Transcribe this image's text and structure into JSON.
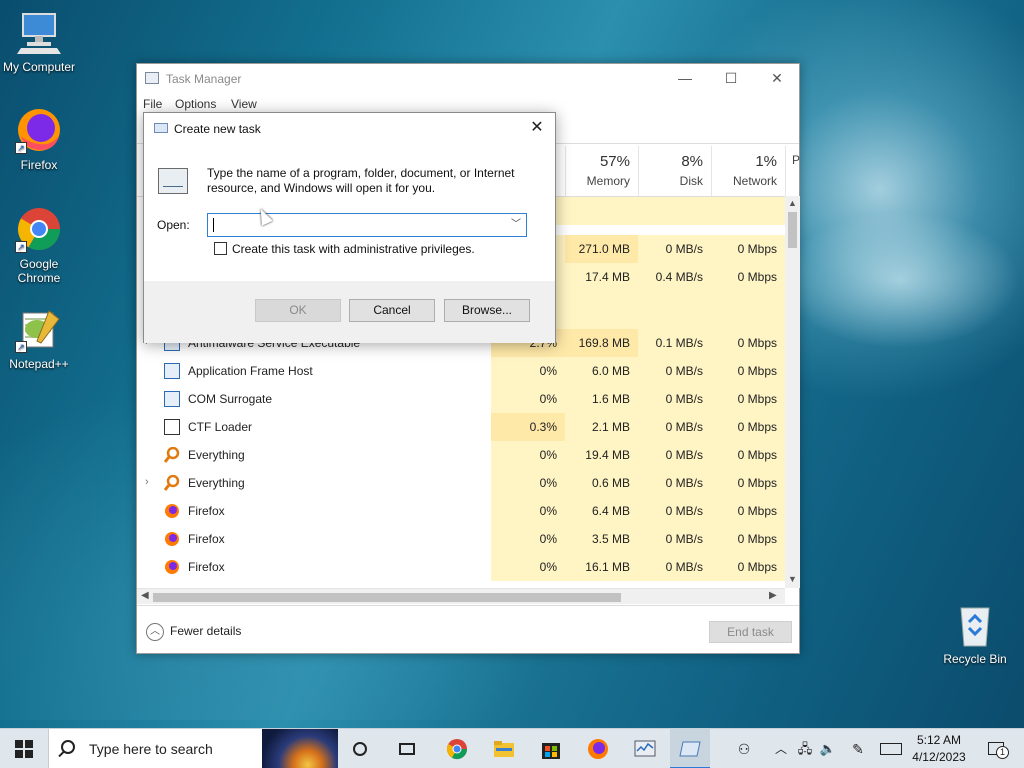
{
  "desktop": {
    "icons": [
      {
        "label": "My Computer"
      },
      {
        "label": "Firefox"
      },
      {
        "label": "Google Chrome"
      },
      {
        "label": "Notepad++"
      },
      {
        "label": "Recycle Bin"
      }
    ]
  },
  "task_manager": {
    "title": "Task Manager",
    "menu": [
      "File",
      "Options",
      "View"
    ],
    "columns": [
      {
        "pct": "57%",
        "name": "Memory"
      },
      {
        "pct": "8%",
        "name": "Disk"
      },
      {
        "pct": "1%",
        "name": "Network"
      },
      {
        "pct": "",
        "name": "P"
      }
    ],
    "rows": [
      {
        "name": "",
        "cpu": "",
        "mem": "",
        "disk": "",
        "net": ""
      },
      {
        "name": "",
        "cpu": "",
        "mem": "271.0 MB",
        "disk": "0 MB/s",
        "net": "0 Mbps"
      },
      {
        "name": "",
        "cpu": "",
        "mem": "17.4 MB",
        "disk": "0.4 MB/s",
        "net": "0 Mbps"
      },
      {
        "name": "",
        "cpu": "",
        "mem": "",
        "disk": "",
        "net": ""
      },
      {
        "name": "Antimalware Service Executable",
        "cpu": "2.7%",
        "mem": "169.8 MB",
        "disk": "0.1 MB/s",
        "net": "0 Mbps"
      },
      {
        "name": "Application Frame Host",
        "cpu": "0%",
        "mem": "6.0 MB",
        "disk": "0 MB/s",
        "net": "0 Mbps"
      },
      {
        "name": "COM Surrogate",
        "cpu": "0%",
        "mem": "1.6 MB",
        "disk": "0 MB/s",
        "net": "0 Mbps"
      },
      {
        "name": "CTF Loader",
        "cpu": "0.3%",
        "mem": "2.1 MB",
        "disk": "0 MB/s",
        "net": "0 Mbps"
      },
      {
        "name": "Everything",
        "cpu": "0%",
        "mem": "19.4 MB",
        "disk": "0 MB/s",
        "net": "0 Mbps"
      },
      {
        "name": "Everything",
        "cpu": "0%",
        "mem": "0.6 MB",
        "disk": "0 MB/s",
        "net": "0 Mbps"
      },
      {
        "name": "Firefox",
        "cpu": "0%",
        "mem": "6.4 MB",
        "disk": "0 MB/s",
        "net": "0 Mbps"
      },
      {
        "name": "Firefox",
        "cpu": "0%",
        "mem": "3.5 MB",
        "disk": "0 MB/s",
        "net": "0 Mbps"
      },
      {
        "name": "Firefox",
        "cpu": "0%",
        "mem": "16.1 MB",
        "disk": "0 MB/s",
        "net": "0 Mbps"
      }
    ],
    "fewer_details": "Fewer details",
    "end_task": "End task"
  },
  "dialog": {
    "title": "Create new task",
    "description": "Type the name of a program, folder, document, or Internet resource, and Windows will open it for you.",
    "open_label": "Open:",
    "open_value": "",
    "admin_checkbox_label": "Create this task with administrative privileges.",
    "ok_label": "OK",
    "cancel_label": "Cancel",
    "browse_label": "Browse..."
  },
  "taskbar": {
    "search_placeholder": "Type here to search",
    "time": "5:12 AM",
    "date": "4/12/2023",
    "notification_count": "1"
  }
}
